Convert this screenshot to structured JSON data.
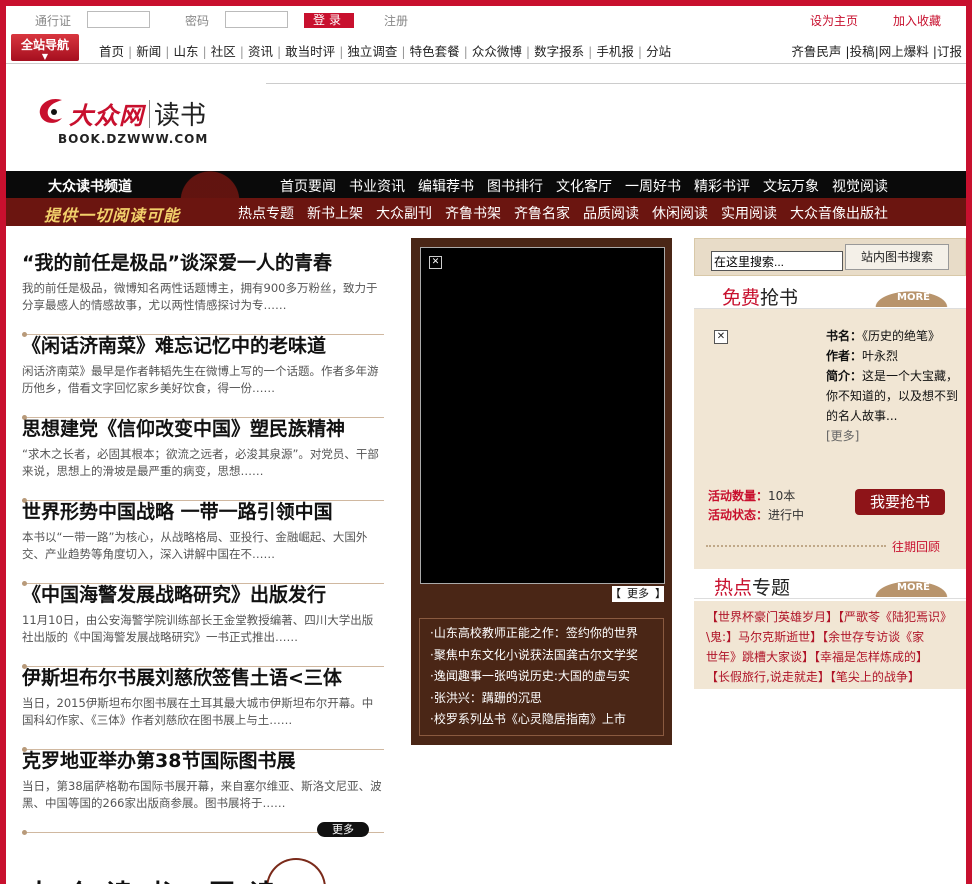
{
  "util": {
    "pass_label": "通行证",
    "pwd_label": "密码",
    "login": "登录",
    "register": "注册",
    "set_home": "设为主页",
    "favorite": "加入收藏"
  },
  "nav": {
    "allnav": "全站导航",
    "links": [
      "首页",
      "新闻",
      "山东",
      "社区",
      "资讯",
      "敢当时评",
      "独立调查",
      "特色套餐",
      "众众微博",
      "数字报系",
      "手机报",
      "分站"
    ],
    "right": "齐鲁民声  |投稿|网上爆料  |订报"
  },
  "logo": {
    "brand": "大众网",
    "channel": "读书",
    "domain": "BOOK.DZWWW.COM"
  },
  "channel": {
    "title": "大众读书频道",
    "slogan": "提供一切阅读可能",
    "menu1": [
      "首页要闻",
      "书业资讯",
      "编辑荐书",
      "图书排行",
      "文化客厅",
      "一周好书",
      "精彩书评",
      "文坛万象",
      "视觉阅读"
    ],
    "menu2": [
      "热点专题",
      "新书上架",
      "大众副刊",
      "齐鲁书架",
      "齐鲁名家",
      "品质阅读",
      "休闲阅读",
      "实用阅读",
      "大众音像出版社"
    ]
  },
  "news": [
    {
      "title": "“我的前任是极品”谈深爱一人的青春",
      "desc": "我的前任是极品，微博知名两性话题博主，拥有900多万粉丝，致力于分享最感人的情感故事，尤以两性情感探讨为专……"
    },
    {
      "title": "《闲话济南菜》难忘记忆中的老味道",
      "desc": "闲话济南菜》最早是作者韩韬先生在微博上写的一个话题。作者多年游历他乡，借看文字回忆家乡美好饮食，得一份……"
    },
    {
      "title": "思想建党《信仰改变中国》塑民族精神",
      "desc": "“求木之长者，必固其根本；欲流之远者，必浚其泉源”。对党员、干部来说，思想上的滑坡是最严重的病变，思想……"
    },
    {
      "title": "世界形势中国战略  一带一路引领中国",
      "desc": "本书以“一带一路”为核心，从战略格局、亚投行、金融崛起、大国外交、产业趋势等角度切入，深入讲解中国在不……"
    },
    {
      "title": "《中国海警发展战略研究》出版发行",
      "desc": "11月10日，由公安海警学院训练部长王金堂教授编著、四川大学出版社出版的《中国海警发展战略研究》一书正式推出……"
    },
    {
      "title": "伊斯坦布尔书展刘慈欣签售土语<三体",
      "desc": "当日，2015伊斯坦布尔图书展在土耳其最大城市伊斯坦布尔开幕。中国科幻作家、《三体》作者刘慈欣在图书展上与土……"
    },
    {
      "title": "克罗地亚举办第38节国际图书展",
      "desc": "当日，第38届萨格勒布国际书展开幕，来自塞尔维亚、斯洛文尼亚、波黑、中国等国的266家出版商参展。图书展将于……"
    }
  ],
  "news_more": "更多",
  "bottom_text": "大众读书 图读",
  "media": {
    "more": "更多",
    "list": [
      "·山东高校教师正能之作：签约你的世界",
      "·聚焦中东文化小说获法国龚古尔文学奖",
      "·逸闻趣事一张鸣说历史:大国的虚与实",
      "·张洪兴：蹒跚的沉思",
      "·校罗系列丛书《心灵隐居指南》上市"
    ]
  },
  "search": {
    "placeholder": "在这里搜索...",
    "button": "站内图书搜索"
  },
  "free": {
    "head_red": "免费",
    "head_rest": "抢书",
    "more": "MORE",
    "book_label": "书名：",
    "book": "《历史的绝笔》",
    "author_label": "作者：",
    "author": "叶永烈",
    "intro_label": "简介：",
    "intro": "这是一个大宝藏，你不知道的，以及想不到的名人故事...",
    "more_link": "[更多]",
    "count_label": "活动数量：",
    "count": "10本",
    "status_label": "活动状态：",
    "status": "进行中",
    "grab": "我要抢书",
    "past": "往期回顾"
  },
  "hot": {
    "head_red": "热点",
    "head_rest": "专题",
    "more": "MORE",
    "lines": [
      "【世界杯豪门英雄岁月】【严歌苓《陆犯焉识》",
      "\\鬼:】马尔克斯逝世】【余世存专访谈《家",
      "世年》跳槽大家谈】【幸福是怎样炼成的】",
      "【长假旅行,说走就走】【笔尖上的战争】"
    ]
  }
}
